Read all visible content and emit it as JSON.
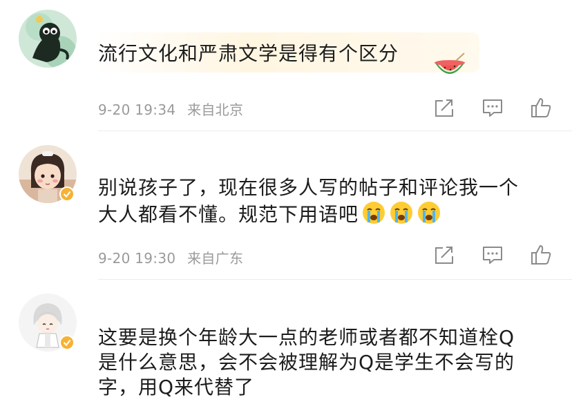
{
  "comments": [
    {
      "text_lines": [
        "流行文化和严肃文学是得有个区分"
      ],
      "date": "9-20 19:34",
      "location": "来自北京",
      "emojis": [
        "watermelon-emoji"
      ],
      "verified": false
    },
    {
      "text_lines": [
        "别说孩子了，现在很多人写的帖子和评论我一个",
        "大人都看不懂。规范下用语吧"
      ],
      "date": "9-20 19:30",
      "location": "来自广东",
      "emojis": [
        "crying-emoji",
        "crying-emoji",
        "crying-emoji"
      ],
      "verified": true
    },
    {
      "text_lines": [
        "这要是换个年龄大一点的老师或者都不知道栓Q",
        "是什么意思，会不会被理解为Q是学生不会写的",
        "字，用Q来代替了"
      ],
      "verified": true
    }
  ],
  "icons": {
    "share": "share-icon",
    "comment": "comment-icon",
    "like": "thumbs-up-icon"
  },
  "colors": {
    "meta_gray": "#9a9a9a",
    "verified_badge": "#f6b234",
    "divider": "#ececec"
  }
}
